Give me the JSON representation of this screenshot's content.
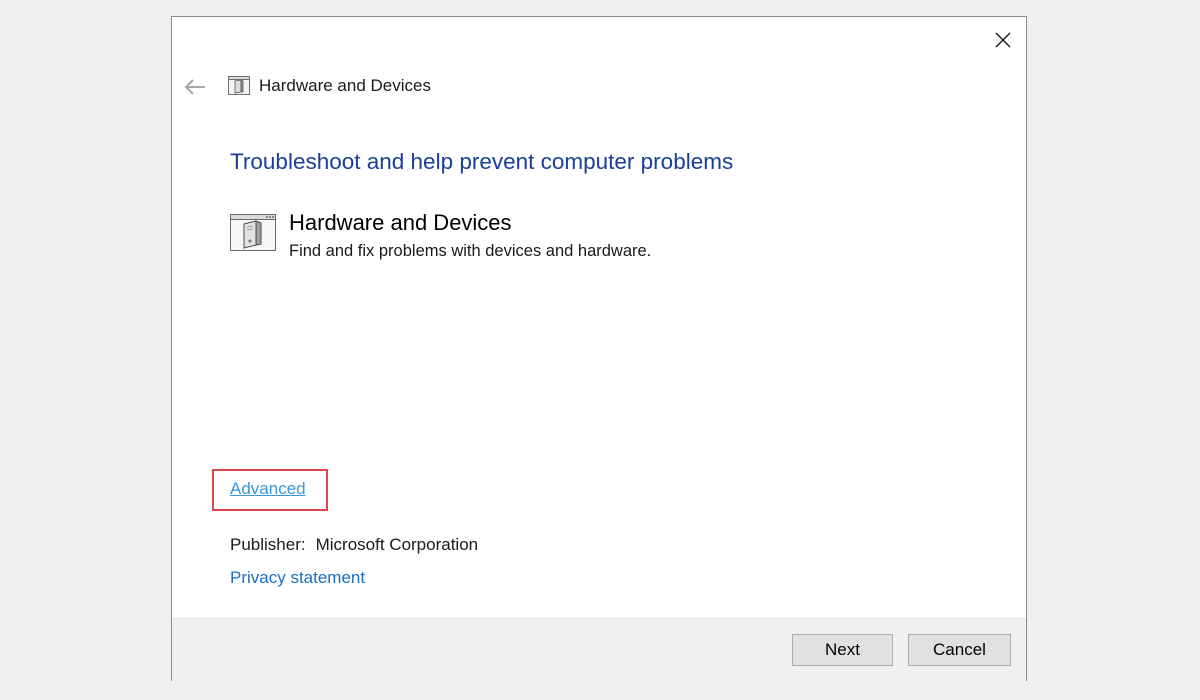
{
  "nav": {
    "title": "Hardware and Devices"
  },
  "main": {
    "heading": "Troubleshoot and help prevent computer problems",
    "item": {
      "title": "Hardware and Devices",
      "description": "Find and fix problems with devices and hardware."
    },
    "advanced_link": "Advanced",
    "publisher_label": "Publisher:",
    "publisher_value": "Microsoft Corporation",
    "privacy_link": "Privacy statement"
  },
  "footer": {
    "next_label": "Next",
    "cancel_label": "Cancel"
  },
  "icons": {
    "back": "back-arrow-icon",
    "close": "close-icon",
    "hardware": "hardware-devices-icon"
  },
  "colors": {
    "heading": "#1a3f95",
    "link": "#1a6ec2",
    "advanced_link": "#3a96dd",
    "highlight_box": "#e0454f",
    "footer_bg": "#f0f0f0",
    "button_bg": "#e1e1e1"
  }
}
